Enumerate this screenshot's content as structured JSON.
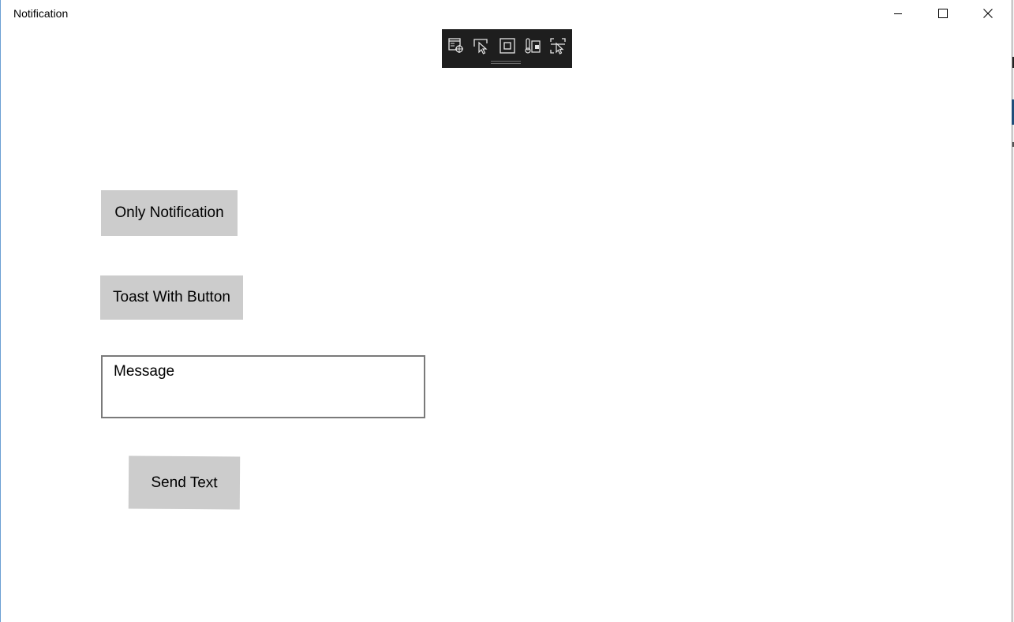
{
  "window": {
    "title": "Notification"
  },
  "caption_buttons": {
    "minimize_icon": "minimize-icon",
    "maximize_icon": "maximize-icon",
    "close_icon": "close-icon"
  },
  "dev_toolbar": {
    "icons": [
      "live-visual-tree-icon",
      "select-element-icon",
      "display-layout-adorners-icon",
      "track-focus-icon",
      "preview-selection-icon"
    ]
  },
  "main": {
    "only_notification_label": "Only Notification",
    "toast_with_button_label": "Toast With Button",
    "message_value": "Message",
    "send_text_label": "Send Text"
  },
  "colors": {
    "button_bg": "#cccccc",
    "input_border": "#7a7a7a",
    "toolbar_bg": "#1e1e1e"
  }
}
